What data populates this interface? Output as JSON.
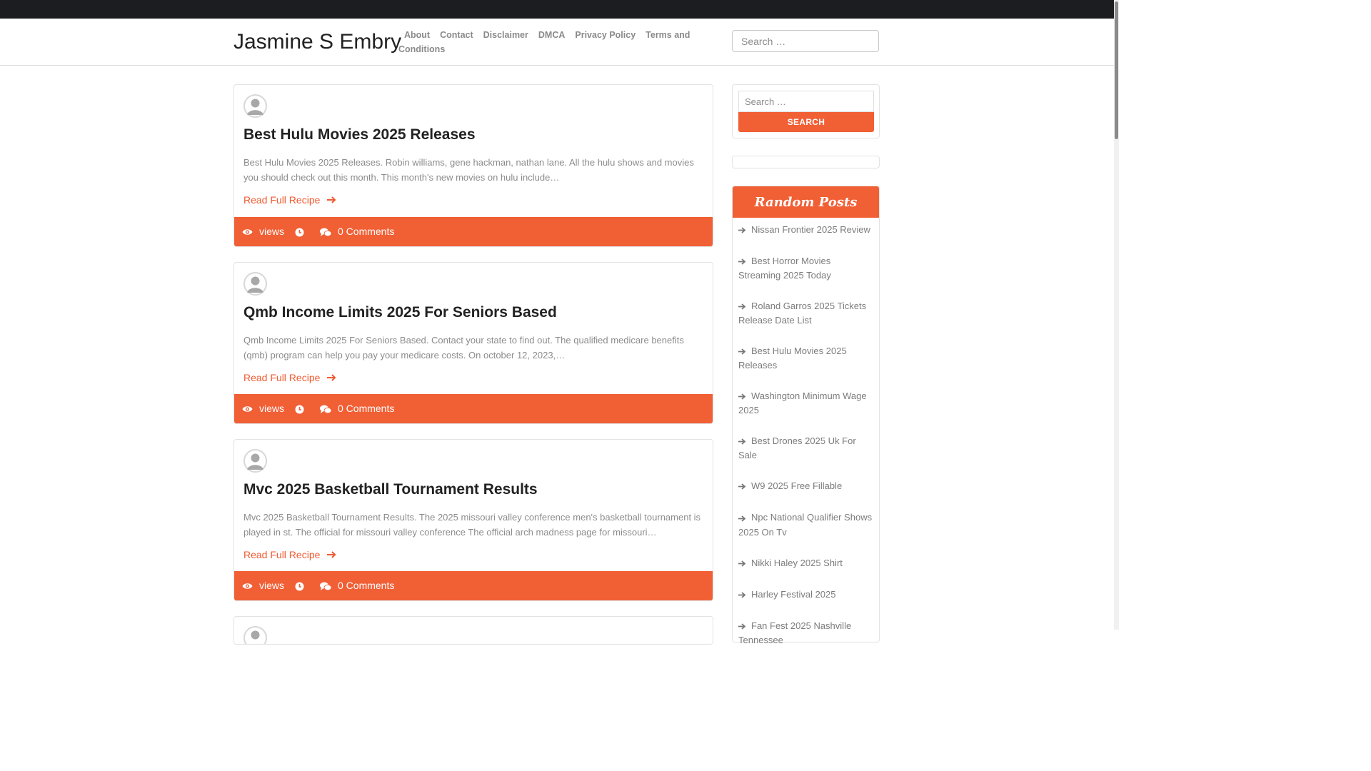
{
  "site": {
    "title": "Jasmine S Embry"
  },
  "nav": {
    "items": [
      "About",
      "Contact",
      "Disclaimer",
      "DMCA",
      "Privacy Policy",
      "Terms and Conditions"
    ]
  },
  "header_search": {
    "placeholder": "Search …"
  },
  "posts": [
    {
      "title": "Best Hulu Movies 2025 Releases",
      "excerpt": "Best Hulu Movies 2025 Releases. Robin williams, gene hackman, nathan lane. All the hulu shows and movies you should check out this month. This month's new movies on hulu include…",
      "read_more": "Read Full Recipe",
      "views": "views",
      "comments": "0 Comments"
    },
    {
      "title": "Qmb Income Limits 2025 For Seniors Based",
      "excerpt": "Qmb Income Limits 2025 For Seniors Based. Contact your state to find out. The qualified medicare benefits (qmb) program can help you pay your medicare costs. On october 12, 2023,…",
      "read_more": "Read Full Recipe",
      "views": "views",
      "comments": "0 Comments"
    },
    {
      "title": "Mvc 2025 Basketball Tournament Results",
      "excerpt": "Mvc 2025 Basketball Tournament Results. The 2025 missouri valley conference men's basketball tournament is played in st. The official for missouri valley conference The official arch madness page for missouri…",
      "read_more": "Read Full Recipe",
      "views": "views",
      "comments": "0 Comments"
    }
  ],
  "sidebar": {
    "search": {
      "placeholder": "Search …",
      "button": "SEARCH"
    },
    "random_posts": {
      "title": "Random Posts",
      "items": [
        "Nissan Frontier 2025 Review",
        "Best Horror Movies Streaming 2025 Today",
        "Roland Garros 2025 Tickets Release Date List",
        "Best Hulu Movies 2025 Releases",
        "Washington Minimum Wage 2025",
        "Best Drones 2025 Uk For Sale",
        "W9 2025 Free Fillable",
        "Npc National Qualifier Shows 2025 On Tv",
        "Nikki Haley 2025 Shirt",
        "Harley Festival 2025",
        "Fan Fest 2025 Nashville Tennessee"
      ]
    }
  },
  "colors": {
    "accent": "#f15f35",
    "topbar": "#1b1d20"
  },
  "icons": {
    "views": "eye-icon",
    "time": "clock-icon",
    "comments": "comments-icon",
    "read_more": "arrow-right-icon",
    "list": "arrow-right-icon"
  }
}
